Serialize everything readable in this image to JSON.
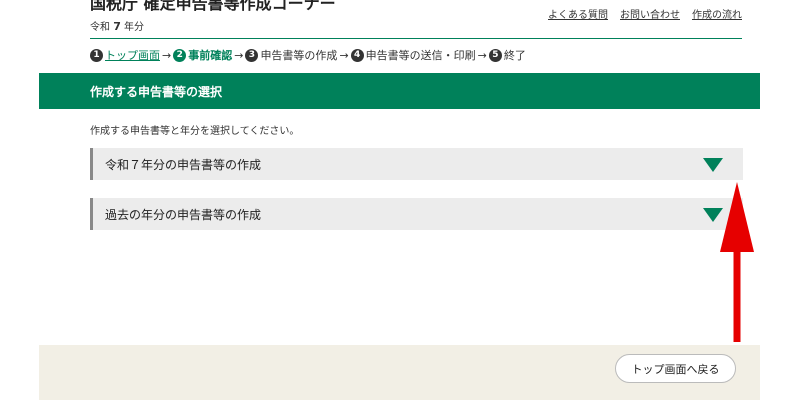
{
  "header": {
    "title": "国税庁 確定申告書等作成コーナー",
    "year_prefix": "令和",
    "year_num": "7",
    "year_suffix": "年分",
    "links": [
      "よくある質問",
      "お問い合わせ",
      "作成の流れ"
    ]
  },
  "steps": [
    {
      "num": "1",
      "label": "トップ画面"
    },
    {
      "num": "2",
      "label": "事前確認"
    },
    {
      "num": "3",
      "label": "申告書等の作成"
    },
    {
      "num": "4",
      "label": "申告書等の送信・印刷"
    },
    {
      "num": "5",
      "label": "終了"
    }
  ],
  "step_arrow": "→",
  "banner": {
    "title": "作成する申告書等の選択"
  },
  "instruction": "作成する申告書等と年分を選択してください。",
  "accordions": [
    {
      "label": "令和７年分の申告書等の作成"
    },
    {
      "label": "過去の年分の申告書等の作成"
    }
  ],
  "footer": {
    "back_label": "トップ画面へ戻る"
  },
  "colors": {
    "accent": "#00815a",
    "annotation_arrow": "#e60000"
  }
}
